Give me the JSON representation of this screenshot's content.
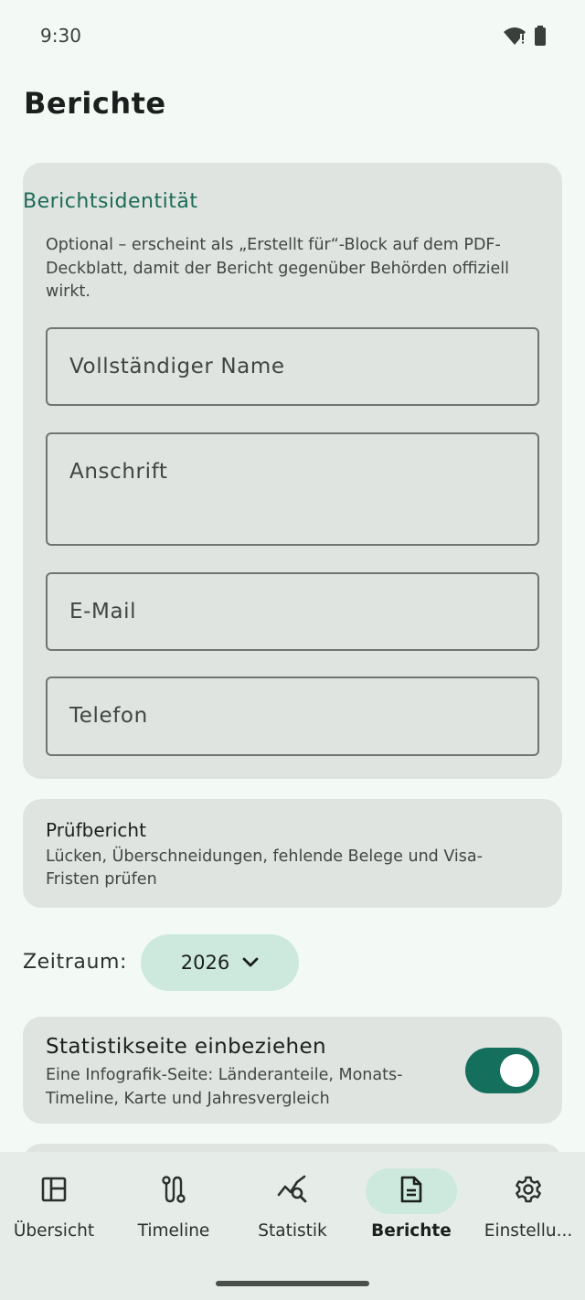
{
  "status_bar": {
    "time": "9:30"
  },
  "page": {
    "title": "Berichte"
  },
  "identity": {
    "title": "Berichtsidentität",
    "description": "Optional – erscheint als „Erstellt für“-Block auf dem PDF-Deckblatt, damit der Bericht gegenüber Behörden offiziell wirkt.",
    "fields": {
      "name": "Vollständiger Name",
      "address": "Anschrift",
      "email": "E-Mail",
      "phone": "Telefon"
    }
  },
  "check_report": {
    "title": "Prüfbericht",
    "description": "Lücken, Überschneidungen, fehlende Belege und Visa-Fristen prüfen"
  },
  "period": {
    "label": "Zeitraum:",
    "value": "2026"
  },
  "stats_page": {
    "title": "Statistikseite einbeziehen",
    "description": "Eine Infografik-Seite: Länderanteile, Monats-Timeline, Karte und Jahresvergleich",
    "enabled": true
  },
  "nav": {
    "items": [
      {
        "label": "Übersicht",
        "icon": "dashboard-icon"
      },
      {
        "label": "Timeline",
        "icon": "route-icon"
      },
      {
        "label": "Statistik",
        "icon": "query-stats-icon"
      },
      {
        "label": "Berichte",
        "icon": "document-icon",
        "active": true
      },
      {
        "label": "Einstellu...",
        "icon": "gear-icon"
      }
    ]
  },
  "colors": {
    "accent": "#1c6b57",
    "toggle_on": "#14705d",
    "chip": "#cde9dd",
    "card": "#dfe4e0",
    "background": "#f3faf5"
  }
}
